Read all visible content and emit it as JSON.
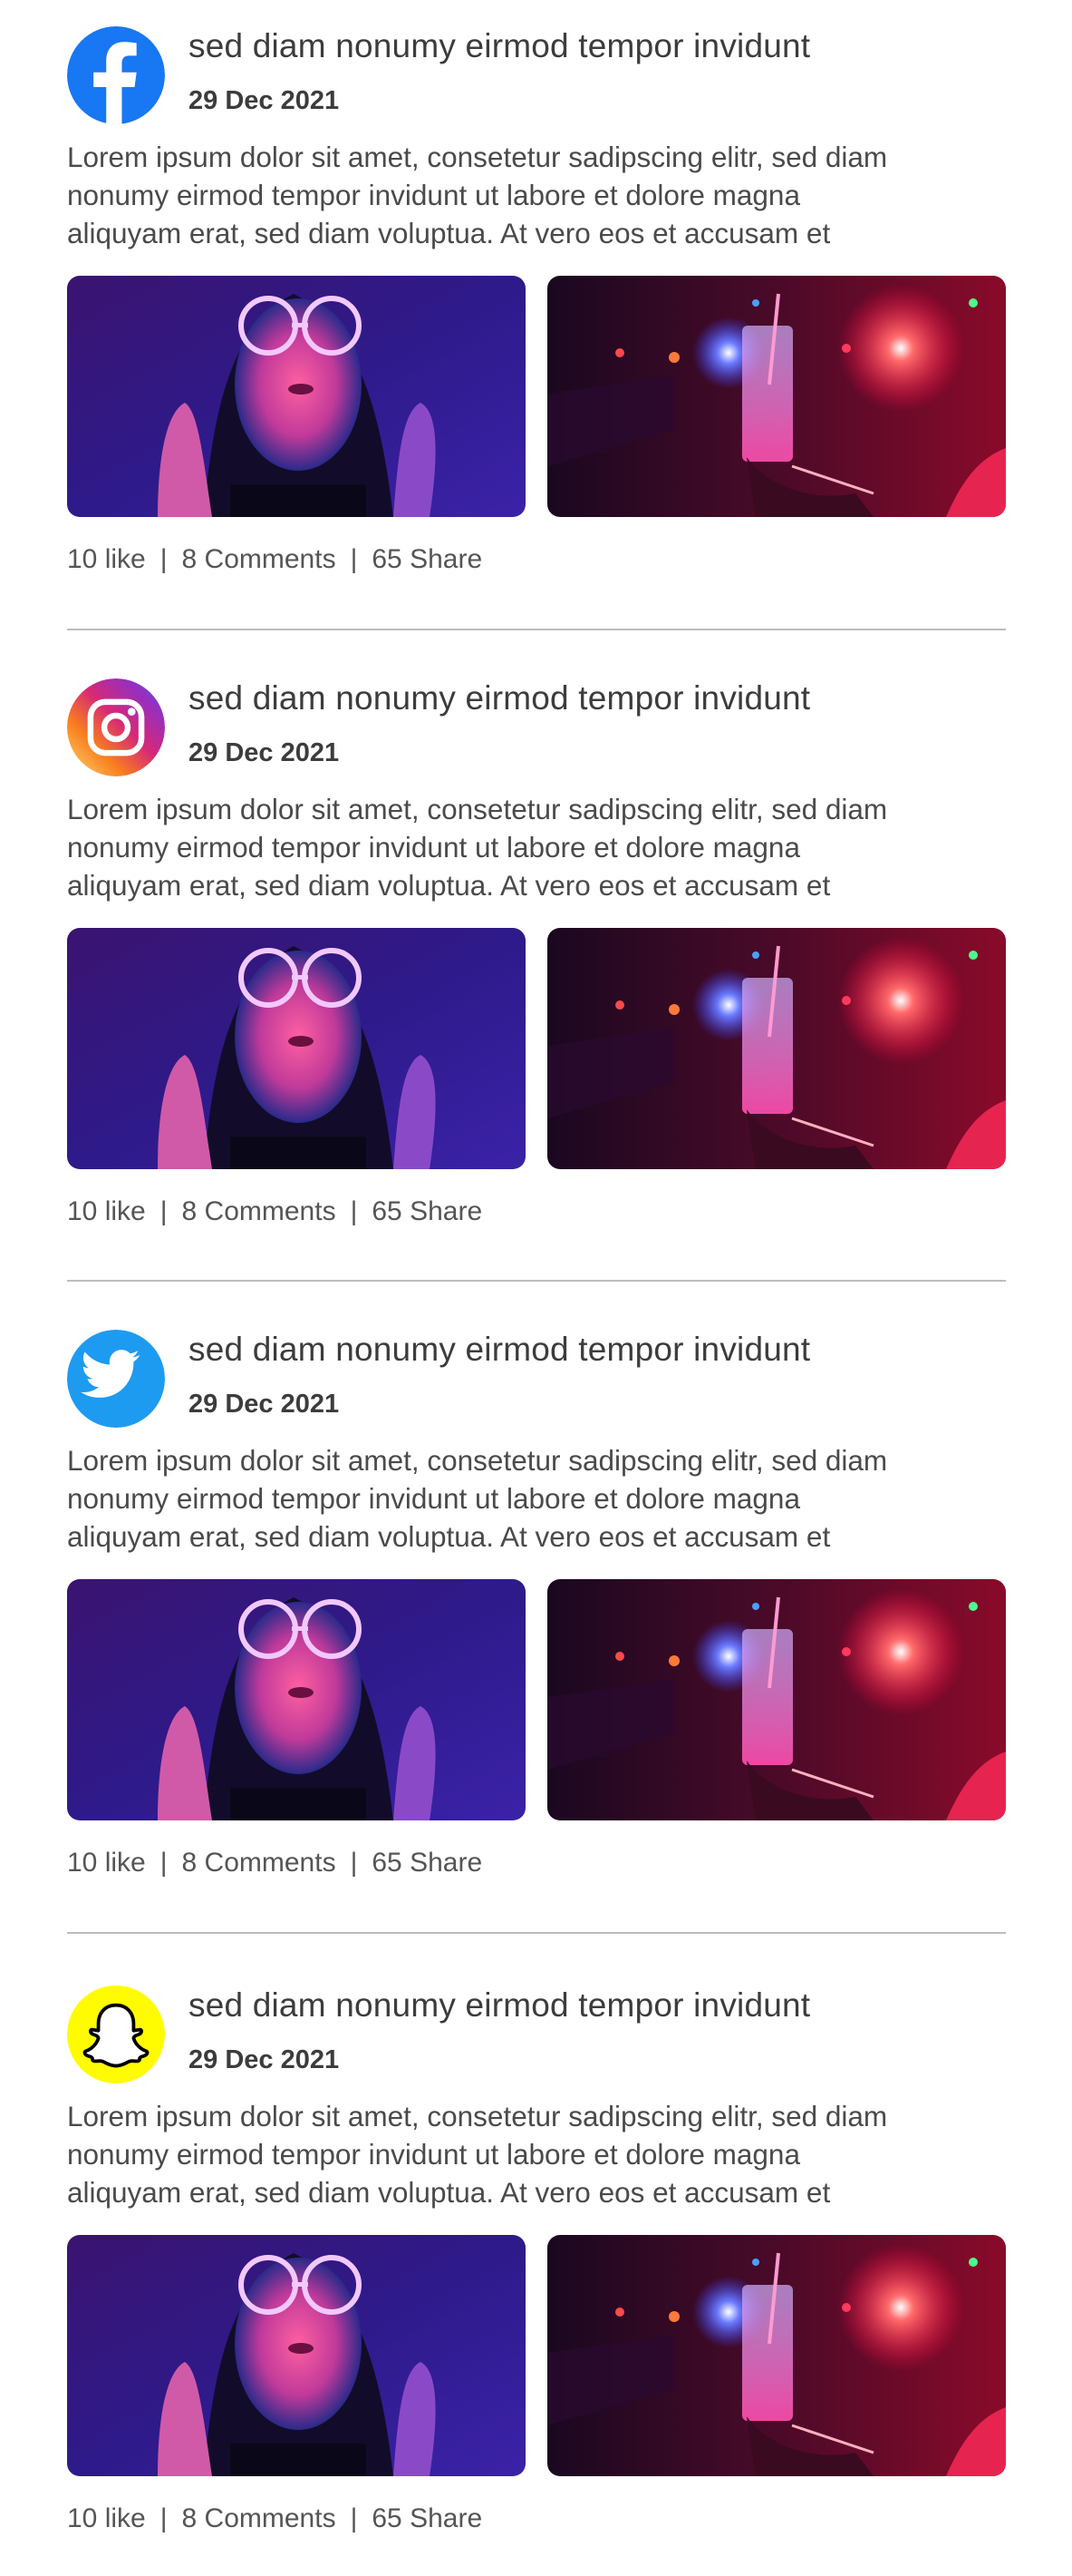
{
  "posts": [
    {
      "network": "facebook",
      "logo_icon": "facebook-icon",
      "logo_color": "#1877f2",
      "title": "sed diam nonumy eirmod tempor invidunt",
      "date": "29 Dec 2021",
      "body": "Lorem ipsum dolor sit amet, consetetur sadipscing elitr, sed diam\nnonumy eirmod tempor invidunt ut labore et dolore magna\naliquyam erat, sed diam voluptua. At vero eos et accusam et",
      "images": [
        "woman-neon-glasses-image",
        "neon-drink-glass-image"
      ],
      "likes": "10 like",
      "comments": "8 Comments",
      "shares": "65 Share",
      "separator": "|"
    },
    {
      "network": "instagram",
      "logo_icon": "instagram-icon",
      "logo_color": "#e1306c",
      "title": "sed diam nonumy eirmod tempor invidunt",
      "date": "29 Dec 2021",
      "body": "Lorem ipsum dolor sit amet, consetetur sadipscing elitr, sed diam\nnonumy eirmod tempor invidunt ut labore et dolore magna\naliquyam erat, sed diam voluptua. At vero eos et accusam et",
      "images": [
        "woman-neon-glasses-image",
        "neon-drink-glass-image"
      ],
      "likes": "10 like",
      "comments": "8 Comments",
      "shares": "65 Share",
      "separator": "|"
    },
    {
      "network": "twitter",
      "logo_icon": "twitter-icon",
      "logo_color": "#1d9bf0",
      "title": "sed diam nonumy eirmod tempor invidunt",
      "date": "29 Dec 2021",
      "body": "Lorem ipsum dolor sit amet, consetetur sadipscing elitr, sed diam\nnonumy eirmod tempor invidunt ut labore et dolore magna\naliquyam erat, sed diam voluptua. At vero eos et accusam et",
      "images": [
        "woman-neon-glasses-image",
        "neon-drink-glass-image"
      ],
      "likes": "10 like",
      "comments": "8 Comments",
      "shares": "65 Share",
      "separator": "|"
    },
    {
      "network": "snapchat",
      "logo_icon": "snapchat-icon",
      "logo_color": "#fffc00",
      "title": "sed diam nonumy eirmod tempor invidunt",
      "date": "29 Dec 2021",
      "body": "Lorem ipsum dolor sit amet, consetetur sadipscing elitr, sed diam\nnonumy eirmod tempor invidunt ut labore et dolore magna\naliquyam erat, sed diam voluptua. At vero eos et accusam et",
      "images": [
        "woman-neon-glasses-image",
        "neon-drink-glass-image"
      ],
      "likes": "10 like",
      "comments": "8 Comments",
      "shares": "65 Share",
      "separator": "|"
    }
  ],
  "colors": {
    "text": "#3c3c3c",
    "divider": "#bdbdbd",
    "background": "#ffffff"
  }
}
